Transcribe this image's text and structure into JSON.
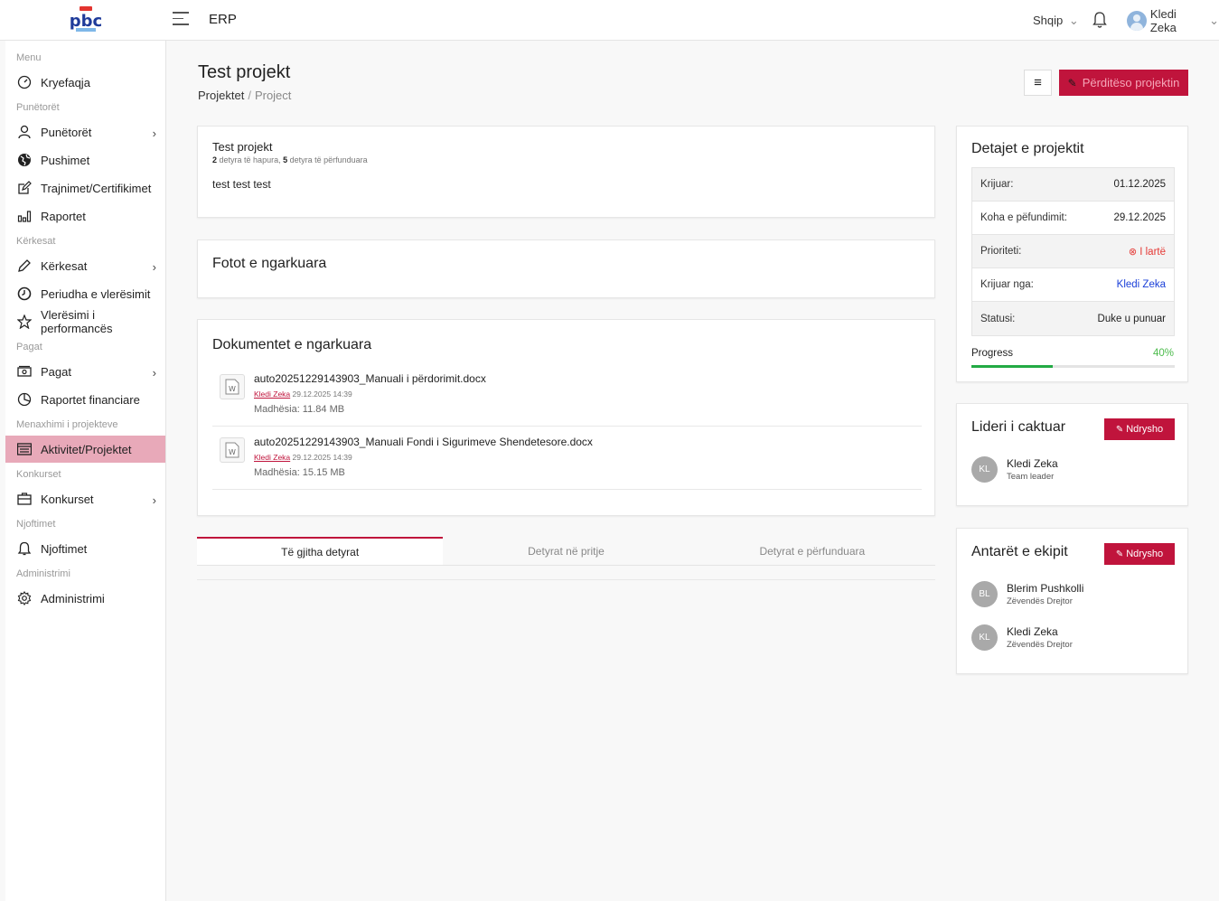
{
  "header": {
    "app_title": "ERP",
    "language": "Shqip",
    "user_name": "Kledi Zeka",
    "icons": [
      "menu-icon",
      "bell-icon",
      "user-avatar-icon",
      "chevron-down-icon"
    ]
  },
  "sidebar": {
    "sections": {
      "menu": "Menu",
      "employees": "Punëtorët",
      "requests": "Kërkesat",
      "salaries": "Pagat",
      "projects": "Menaxhimi i projekteve",
      "competitions": "Konkurset",
      "notifications": "Njoftimet",
      "administration": "Administrimi"
    },
    "items": {
      "home": "Kryefaqja",
      "employees": "Punëtorët",
      "holidays": "Pushimet",
      "trainings": "Trajnimet/Certifikimet",
      "reports": "Raportet",
      "requests": "Kërkesat",
      "evaluation_period": "Periudha e vlerësimit",
      "performance": "Vlerësimi i performancës",
      "salaries": "Pagat",
      "financial_reports": "Raportet financiare",
      "activities": "Aktivitet/Projektet",
      "competitions": "Konkurset",
      "notifications": "Njoftimet",
      "administration": "Administrimi"
    },
    "active_color": "#e8a9b9"
  },
  "page": {
    "title": "Test projekt",
    "breadcrumb_root": "Projektet",
    "breadcrumb_sep": "/",
    "breadcrumb_current": "Project",
    "update_button": "Përditëso projektin",
    "accent": "#c0143c"
  },
  "project": {
    "title": "Test projekt",
    "open_count": "2",
    "open_label": "detyra të hapura,",
    "done_count": "5",
    "done_label": "detyra të përfunduara",
    "description": "test test test"
  },
  "photos": {
    "heading": "Fotot e ngarkuara"
  },
  "documents": {
    "heading": "Dokumentet e ngarkuara",
    "files": [
      {
        "name": "auto20251229143903_Manuali i përdorimit.docx",
        "author": "Kledi Zeka",
        "date": "29.12.2025 14:39",
        "size": "Madhësia: 11.84 MB"
      },
      {
        "name": "auto20251229143903_Manuali Fondi i Sigurimeve Shendetesore.docx",
        "author": "Kledi Zeka",
        "date": "29.12.2025 14:39",
        "size": "Madhësia: 15.15 MB"
      }
    ]
  },
  "tabs": [
    "Të gjitha detyrat",
    "Detyrat në pritje",
    "Detyrat e përfunduara"
  ],
  "details": {
    "heading": "Detajet e projektit",
    "rows": [
      {
        "label": "Krijuar:",
        "value": "01.12.2025"
      },
      {
        "label": "Koha e pëfundimit:",
        "value": "29.12.2025"
      },
      {
        "label": "Prioriteti:",
        "value": "I lartë"
      },
      {
        "label": "Krijuar nga:",
        "value": "Kledi Zeka"
      },
      {
        "label": "Statusi:",
        "value": "Duke u punuar"
      }
    ],
    "progress_label": "Progress",
    "progress_text": "40%",
    "progress_value": 0.4,
    "priority_color": "#e53935"
  },
  "leader": {
    "heading": "Lideri i caktuar",
    "edit": "Ndrysho",
    "initials": "KL",
    "name": "Kledi Zeka",
    "role": "Team leader"
  },
  "team": {
    "heading": "Antarët e ekipit",
    "edit": "Ndrysho",
    "members": [
      {
        "initials": "BL",
        "name": "Blerim Pushkolli",
        "role": "Zëvendës Drejtor"
      },
      {
        "initials": "KL",
        "name": "Kledi Zeka",
        "role": "Zëvendës Drejtor"
      }
    ]
  }
}
